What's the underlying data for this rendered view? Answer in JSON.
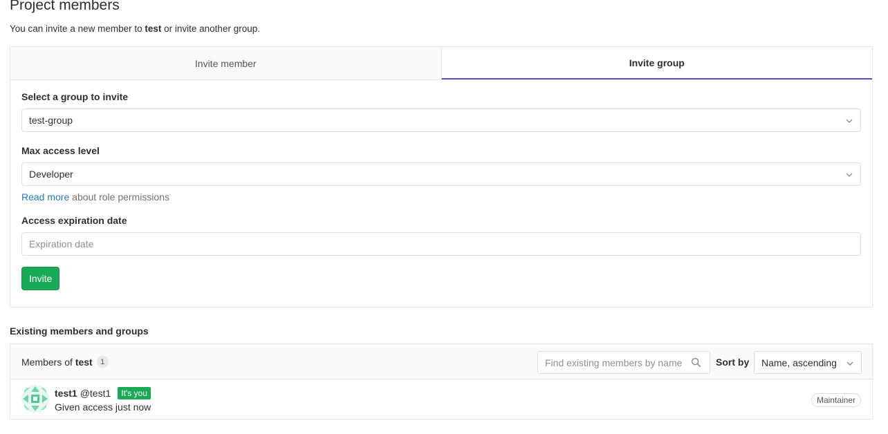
{
  "page": {
    "title": "Project members",
    "intro_prefix": "You can invite a new member to ",
    "intro_project": "test",
    "intro_suffix": " or invite another group."
  },
  "tabs": [
    {
      "label": "Invite member",
      "active": false
    },
    {
      "label": "Invite group",
      "active": true
    }
  ],
  "invite_form": {
    "group_label": "Select a group to invite",
    "group_value": "test-group",
    "access_label": "Max access level",
    "access_value": "Developer",
    "help_link": "Read more",
    "help_text": " about role permissions",
    "expiration_label": "Access expiration date",
    "expiration_placeholder": "Expiration date",
    "submit_label": "Invite"
  },
  "existing": {
    "title": "Existing members and groups",
    "members_of_prefix": "Members of ",
    "project": "test",
    "count": "1",
    "search_placeholder": "Find existing members by name",
    "sort_label": "Sort by",
    "sort_value": "Name, ascending"
  },
  "members": [
    {
      "name": "test1",
      "username": "@test1",
      "you_badge": "It's you",
      "access_text": "Given access just now",
      "role": "Maintainer"
    }
  ],
  "colors": {
    "accent_tab": "#6b4fbb",
    "success": "#1aaa55",
    "link": "#1f78d1"
  }
}
